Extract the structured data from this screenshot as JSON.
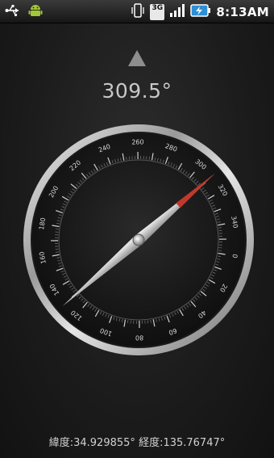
{
  "status_bar": {
    "time": "8:13AM",
    "network_type": "3G",
    "icons": [
      "usb-icon",
      "android-icon",
      "vibrate-icon",
      "network-3g-icon",
      "signal-icon",
      "battery-charging-icon"
    ]
  },
  "compass": {
    "heading_text": "309.5°",
    "heading_degrees": 309.5,
    "needle_degrees": 49,
    "dial_labels": [
      "0",
      "20",
      "40",
      "60",
      "80",
      "100",
      "120",
      "140",
      "160",
      "180",
      "200",
      "220",
      "240",
      "260",
      "280",
      "300",
      "320",
      "340"
    ],
    "needle_north_color": "#c0392b"
  },
  "location": {
    "latitude_text": "緯度:34.929855°",
    "longitude_text": "経度:135.76747°"
  }
}
